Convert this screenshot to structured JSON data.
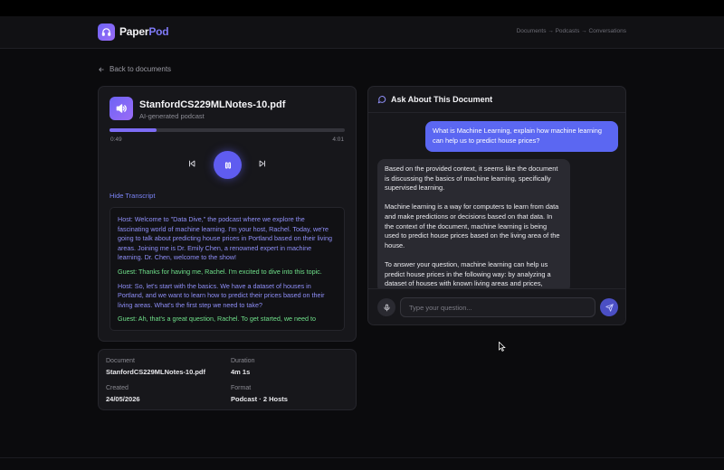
{
  "app": {
    "name_part1": "Paper",
    "name_part2": "Pod"
  },
  "nav": {
    "breadcrumb": "Documents → Podcasts → Conversations"
  },
  "back_link": {
    "label": "Back to documents"
  },
  "player": {
    "file_name": "StanfordCS229MLNotes-10.pdf",
    "subtitle": "AI-generated podcast",
    "current_time": "0:49",
    "total_time": "4:01",
    "progress": 0.2,
    "hide_transcript_label": "Hide Transcript"
  },
  "transcript": [
    {
      "speaker": "host",
      "text": "Host: Welcome to \"Data Dive,\" the podcast where we explore the fascinating world of machine learning. I'm your host, Rachel. Today, we're going to talk about predicting house prices in Portland based on their living areas. Joining me is Dr. Emily Chen, a renowned expert in machine learning. Dr. Chen, welcome to the show!"
    },
    {
      "speaker": "guest",
      "text": "Guest: Thanks for having me, Rachel. I'm excited to dive into this topic."
    },
    {
      "speaker": "host",
      "text": "Host: So, let's start with the basics. We have a dataset of houses in Portland, and we want to learn how to predict their prices based on their living areas. What's the first step we need to take?"
    },
    {
      "speaker": "guest",
      "text": "Guest: Ah, that's a great question, Rachel. To get started, we need to"
    }
  ],
  "chat": {
    "title": "Ask About This Document",
    "user_message": "What is Machine Learning, explain how machine learning can help us to predict house prices?",
    "bot_paragraphs": [
      "Based on the provided context, it seems like the document is discussing the basics of machine learning, specifically supervised learning.",
      "Machine learning is a way for computers to learn from data and make predictions or decisions based on that data. In the context of the document, machine learning is being used to predict house prices based on the living area of the house.",
      "To answer your question, machine learning can help us predict house prices in the following way: by analyzing a dataset of houses with known living areas and prices,"
    ],
    "input_placeholder": "Type your question..."
  },
  "meta": {
    "document_label": "Document",
    "document_value": "StanfordCS229MLNotes-10.pdf",
    "duration_label": "Duration",
    "duration_value": "4m 1s",
    "created_label": "Created",
    "created_value": "24/05/2026",
    "format_label": "Format",
    "format_value": "Podcast · 2 Hosts"
  },
  "colors": {
    "accent": "#6d63f5",
    "host_text": "#8f8ff8",
    "guest_text": "#6fe08a",
    "user_bubble": "#5b67f2"
  }
}
